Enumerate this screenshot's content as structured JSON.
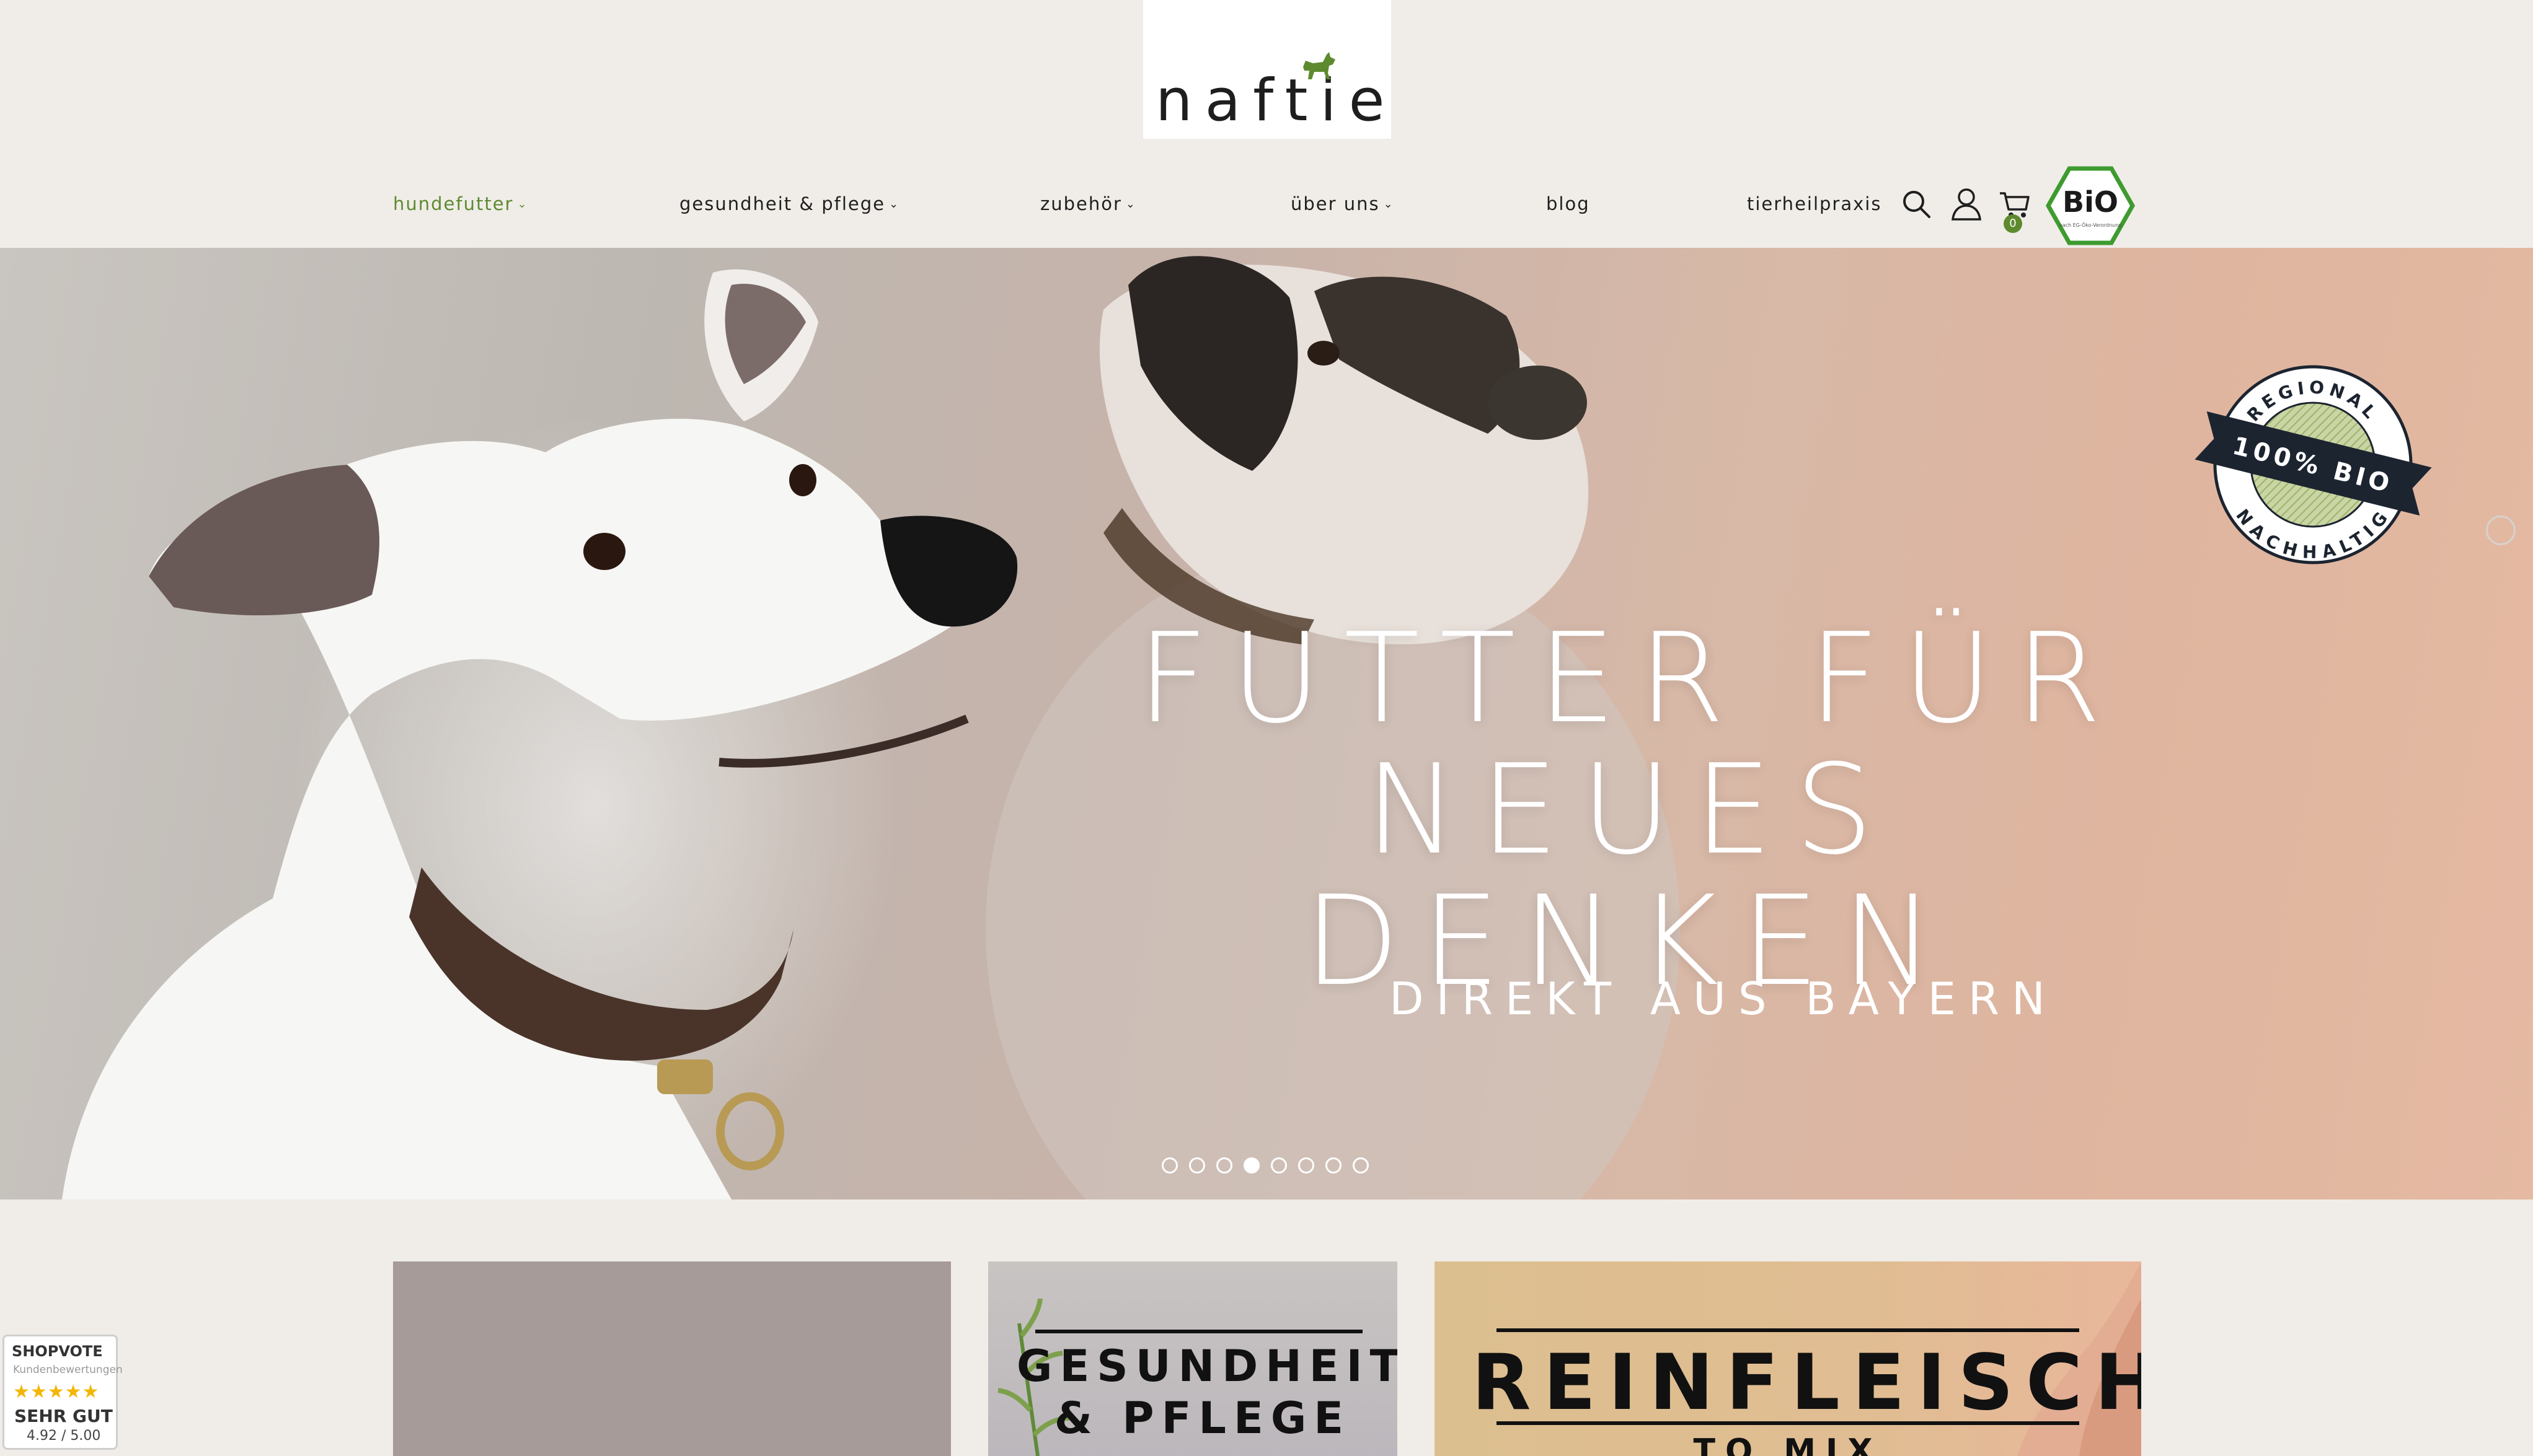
{
  "brand": {
    "logo_text": "naftie"
  },
  "nav": {
    "items": [
      {
        "label": "hundefutter",
        "has_dropdown": true,
        "active": true
      },
      {
        "label": "gesundheit & pflege",
        "has_dropdown": true,
        "active": false
      },
      {
        "label": "zubehör",
        "has_dropdown": true,
        "active": false
      },
      {
        "label": "über uns",
        "has_dropdown": true,
        "active": false
      },
      {
        "label": "blog",
        "has_dropdown": false,
        "active": false
      },
      {
        "label": "tierheilpraxis",
        "has_dropdown": false,
        "active": false
      }
    ],
    "icons": [
      "search-icon",
      "user-icon",
      "cart-icon"
    ],
    "cart_count": "0",
    "bio_badge": {
      "label": "BiO",
      "caption": "nach EG-Öko-Verordnung"
    }
  },
  "hero": {
    "title_line1": "FUTTER FÜR",
    "title_line2": "NEUES DENKEN",
    "subtitle": "DIREKT AUS BAYERN",
    "seal": {
      "top": "REGIONAL",
      "band": "100% BIO",
      "bottom": "NACHHALTIG"
    },
    "slide_count": 8,
    "active_slide": 4
  },
  "tiles": [
    {
      "label": ""
    },
    {
      "line1": "GESUNDHEIT",
      "line2": "& PFLEGE"
    },
    {
      "line1": "REINFLEISCH",
      "line2": "TO MIX"
    }
  ],
  "shopvote": {
    "brand": "SHOPVOTE",
    "subtitle": "Kundenbewertungen",
    "stars": "★★★★★",
    "rating_text": "SEHR GUT",
    "score": "4.92 / 5.00"
  },
  "colors": {
    "background": "#f0ede8",
    "accent_green": "#5e8a2f",
    "text_dark": "#1f1f1f"
  }
}
